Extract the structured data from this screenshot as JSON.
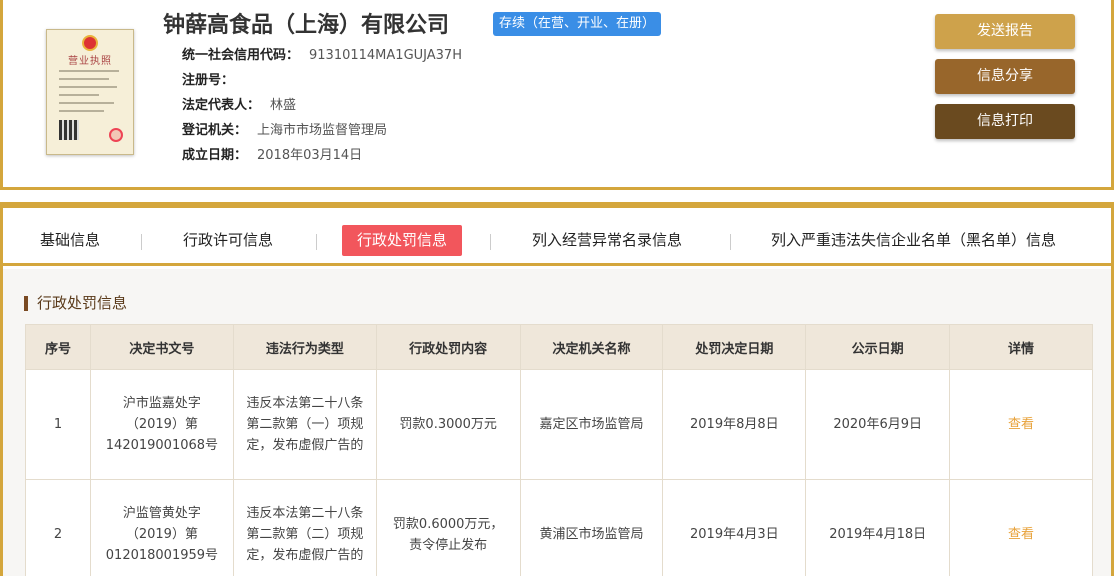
{
  "company": {
    "name": "钟薛高食品（上海）有限公司",
    "status": "存续（在营、开业、在册）",
    "license_title": "营业执照",
    "fields": [
      {
        "label": "统一社会信用代码：",
        "value": "91310114MA1GUJA37H"
      },
      {
        "label": "注册号：",
        "value": ""
      },
      {
        "label": "法定代表人：",
        "value": "林盛"
      },
      {
        "label": "登记机关：",
        "value": "上海市市场监督管理局"
      },
      {
        "label": "成立日期：",
        "value": "2018年03月14日"
      }
    ]
  },
  "actions": {
    "report": "发送报告",
    "share": "信息分享",
    "print": "信息打印"
  },
  "tabs": [
    {
      "label": "基础信息"
    },
    {
      "label": "行政许可信息"
    },
    {
      "label": "行政处罚信息"
    },
    {
      "label": "列入经营异常名录信息"
    },
    {
      "label": "列入严重违法失信企业名单（黑名单）信息"
    }
  ],
  "section_title": "行政处罚信息",
  "table": {
    "headers": [
      "序号",
      "决定书文号",
      "违法行为类型",
      "行政处罚内容",
      "决定机关名称",
      "处罚决定日期",
      "公示日期",
      "详情"
    ],
    "rows": [
      {
        "index": "1",
        "doc_no": "沪市监嘉处字（2019）第142019001068号",
        "violation": "违反本法第二十八条第二款第（一）项规定，发布虚假广告的",
        "penalty": "罚款0.3000万元",
        "authority": "嘉定区市场监管局",
        "decision_date": "2019年8月8日",
        "publish_date": "2020年6月9日",
        "detail": "查看"
      },
      {
        "index": "2",
        "doc_no": "沪监管黄处字（2019）第012018001959号",
        "violation": "违反本法第二十八条第二款第（二）项规定，发布虚假广告的",
        "penalty": "罚款0.6000万元，责令停止发布",
        "authority": "黄浦区市场监管局",
        "decision_date": "2019年4月3日",
        "publish_date": "2019年4月18日",
        "detail": "查看"
      }
    ]
  },
  "colors": {
    "gold_border": "#d4a63c",
    "active_tab": "#f2565c",
    "status_badge": "#3a8ee6",
    "link": "#e8a23a"
  }
}
